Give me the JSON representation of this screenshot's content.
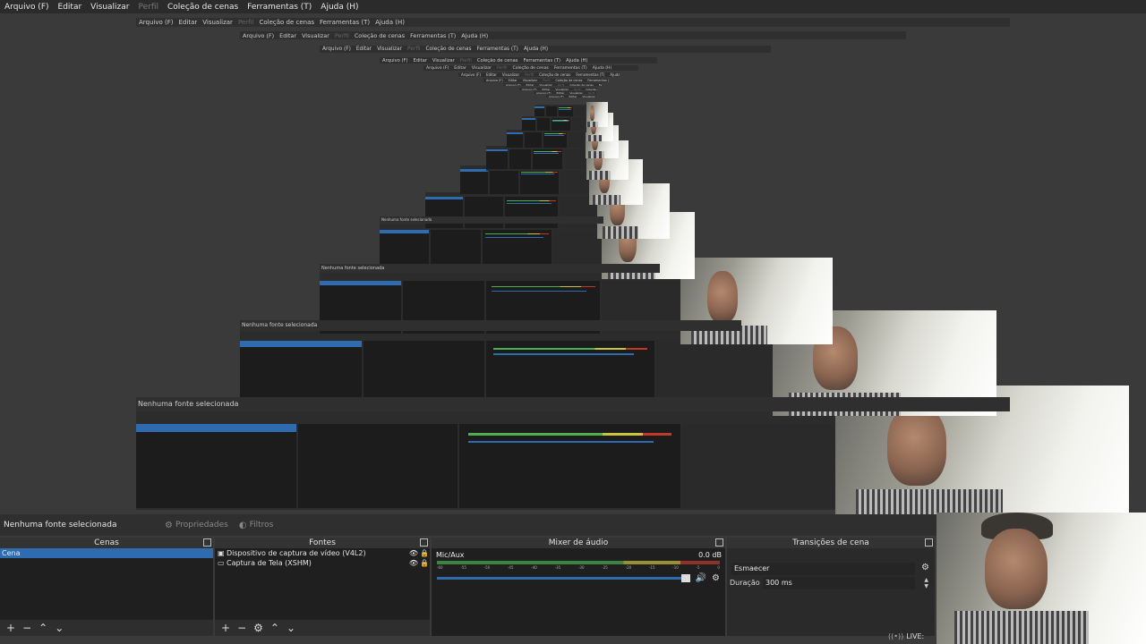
{
  "menu": [
    {
      "label": "Arquivo (F)",
      "enabled": true
    },
    {
      "label": "Editar",
      "enabled": true
    },
    {
      "label": "Visualizar",
      "enabled": true
    },
    {
      "label": "Perfil",
      "enabled": false
    },
    {
      "label": "Coleção de cenas",
      "enabled": true
    },
    {
      "label": "Ferramentas (T)",
      "enabled": true
    },
    {
      "label": "Ajuda (H)",
      "enabled": true
    }
  ],
  "status": {
    "selection_text": "Nenhuma fonte selecionada",
    "properties_label": "Propriedades",
    "filters_label": "Filtros"
  },
  "docks": {
    "scenes": {
      "title": "Cenas",
      "items": [
        "Cena"
      ],
      "selected_index": 0
    },
    "sources": {
      "title": "Fontes",
      "items": [
        {
          "icon": "camera-icon",
          "name": "Dispositivo de captura de vídeo (V4L2)"
        },
        {
          "icon": "monitor-icon",
          "name": "Captura de Tela (XSHM)"
        }
      ]
    },
    "mixer": {
      "title": "Mixer de áudio",
      "channel_name": "Mic/Aux",
      "db_value": "0.0 dB",
      "tick_labels": [
        "-60",
        "-55",
        "-50",
        "-45",
        "-40",
        "-35",
        "-30",
        "-25",
        "-20",
        "-15",
        "-10",
        "-5",
        "0"
      ],
      "volume_fraction": 1.0
    },
    "transitions": {
      "title": "Transições de cena",
      "selected_transition": "Esmaecer",
      "duration_label": "Duração",
      "duration_value": "300 ms"
    }
  },
  "live_indicator": "LIVE:",
  "colors": {
    "background": "#3a3a3a",
    "panel": "#1f1f1f",
    "selection": "#2f6bb0"
  }
}
